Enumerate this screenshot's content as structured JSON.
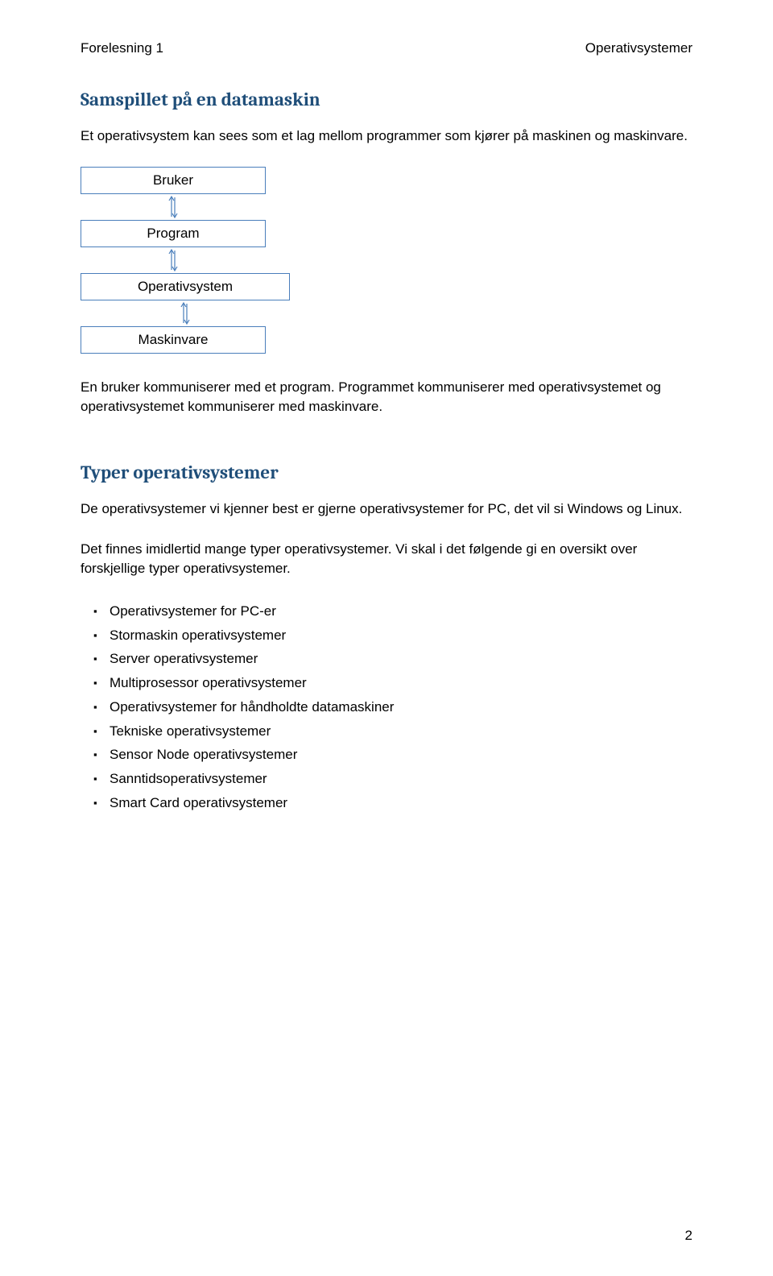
{
  "header": {
    "left": "Forelesning 1",
    "right": "Operativsystemer"
  },
  "section1": {
    "heading": "Samspillet på en datamaskin",
    "para1": "Et operativsystem kan sees som et lag mellom programmer som kjører på maskinen og maskinvare.",
    "diagram": {
      "box1": "Bruker",
      "box2": "Program",
      "box3": "Operativsystem",
      "box4": "Maskinvare"
    },
    "para2": "En bruker kommuniserer med et program. Programmet kommuniserer med operativsystemet og operativsystemet kommuniserer med maskinvare."
  },
  "section2": {
    "heading": "Typer operativsystemer",
    "para1": "De operativsystemer vi kjenner best er gjerne operativsystemer for PC, det vil si Windows og Linux.",
    "para2": "Det finnes imidlertid mange typer operativsystemer. Vi skal i det følgende gi en oversikt over forskjellige typer operativsystemer.",
    "bullets": [
      "Operativsystemer for PC-er",
      "Stormaskin operativsystemer",
      "Server operativsystemer",
      "Multiprosessor operativsystemer",
      "Operativsystemer for håndholdte datamaskiner",
      "Tekniske operativsystemer",
      "Sensor Node operativsystemer",
      "Sanntidsoperativsystemer",
      "Smart Card operativsystemer"
    ]
  },
  "page_number": "2"
}
